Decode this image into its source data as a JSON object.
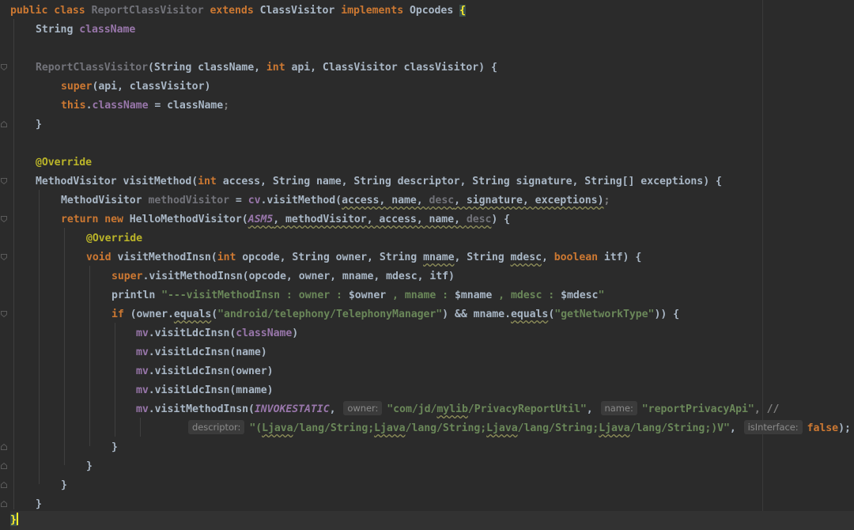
{
  "editor": {
    "line1": {
      "t1": "public class ",
      "t2": "ReportClassVisitor ",
      "t3": "extends ",
      "t4": "ClassVisitor ",
      "t5": "implements ",
      "t6": "Opcodes ",
      "t7": "{"
    },
    "line2": {
      "t1": "String ",
      "t2": "className"
    },
    "line4": {
      "t1": "ReportClassVisitor",
      "t2": "(String className, ",
      "t3": "int ",
      "t4": "api, ClassVisitor classVisitor) {"
    },
    "line5": {
      "t1": "super",
      "t2": "(api, classVisitor)"
    },
    "line6": {
      "t1": "this",
      "t2": ".",
      "t3": "className",
      "t4": " = className",
      "t5": ";"
    },
    "line7": {
      "t1": "}"
    },
    "line9": {
      "t1": "@Override"
    },
    "line10": {
      "t1": "MethodVisitor visitMethod(",
      "t2": "int ",
      "t3": "access, String name, String descriptor, String signature, String[] exceptions) {"
    },
    "line11": {
      "t1": "MethodVisitor ",
      "t2": "methodVisitor",
      "t3": " = ",
      "t4": "cv",
      "t5": ".visitMethod(",
      "t6": "access, name, ",
      "t7": "desc",
      "t8": ", signature, exceptions)",
      "t9": ";"
    },
    "line12": {
      "t1": "return new ",
      "t2": "HelloMethodVisitor(",
      "t3": "ASM5",
      "t4": ", methodVisitor, access, name, ",
      "t5": "desc",
      "t6": ") {"
    },
    "line13": {
      "t1": "@Override"
    },
    "line14": {
      "t1": "void ",
      "t2": "visitMethodInsn(",
      "t3": "int ",
      "t4": "opcode, String owner, String ",
      "t5": "mname",
      "t6": ", String ",
      "t7": "mdesc",
      "t8": ", ",
      "t9": "boolean ",
      "t10": "itf) {"
    },
    "line15": {
      "t1": "super",
      "t2": ".visitMethodInsn(opcode, owner, mname, mdesc, itf)"
    },
    "line16": {
      "t1": "println ",
      "t2": "\"---visitMethodInsn : owner : ",
      "t3": "$owner",
      "t4": " , mname : ",
      "t5": "$mname",
      "t6": " , mdesc : ",
      "t7": "$mdesc",
      "t8": "\""
    },
    "line17": {
      "t1": "if ",
      "t2": "(owner.",
      "t3": "equals",
      "t4": "(",
      "t5": "\"android/telephony/TelephonyManager\"",
      "t6": ") && mname.",
      "t7": "equals",
      "t8": "(",
      "t9": "\"getNetworkType\"",
      "t10": ")) {"
    },
    "line18": {
      "t1": "mv",
      "t2": ".visitLdcInsn(",
      "t3": "className",
      "t4": ")"
    },
    "line19": {
      "t1": "mv",
      "t2": ".visitLdcInsn(name)"
    },
    "line20": {
      "t1": "mv",
      "t2": ".visitLdcInsn(owner)"
    },
    "line21": {
      "t1": "mv",
      "t2": ".visitLdcInsn(mname)"
    },
    "line22": {
      "t1": "mv",
      "t2": ".visitMethodInsn(",
      "t3": "INVOKESTATIC",
      "t4": ", ",
      "hint_owner": "owner:",
      "t5": "\"com/jd/",
      "t6": "mylib",
      "t7": "/PrivacyReportUtil\"",
      "t8": ", ",
      "hint_name": "name:",
      "t9": "\"reportPrivacyApi\"",
      "t10": ", //"
    },
    "line23": {
      "hint_descriptor": "descriptor:",
      "t1": "\"(",
      "t2": "Ljava",
      "t3": "/lang/String;",
      "t4": "Ljava",
      "t5": "/lang/String;",
      "t6": "Ljava",
      "t7": "/lang/String;",
      "t8": "Ljava",
      "t9": "/lang/String;)V\"",
      "t10": ", ",
      "hint_isInterface": "isInterface:",
      "t11": "false",
      "t12": ");"
    },
    "line24": {
      "t1": "}"
    },
    "line25": {
      "t1": "}"
    },
    "line26": {
      "t1": "}"
    },
    "line27": {
      "t1": "}"
    },
    "line28": {
      "t1": "}"
    }
  }
}
